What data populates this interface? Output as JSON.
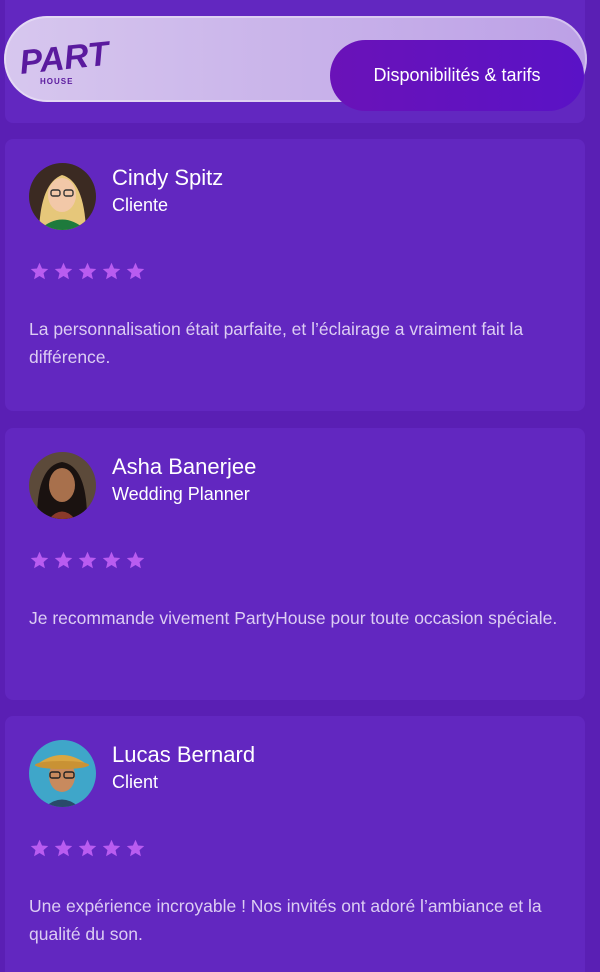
{
  "header": {
    "logo_text": "PARTY HOUSE",
    "cta_label": "Disponibilités & tarifs"
  },
  "colors": {
    "background": "#5a1fb4",
    "card": "#6227c0",
    "star": "#b95cf0",
    "cta": "#6a12b8"
  },
  "testimonials": [
    {
      "name": "Cindy Spitz",
      "role": "Cliente",
      "rating": 5,
      "text": "La personnalisation était parfaite, et l’éclairage a vraiment fait la différence."
    },
    {
      "name": "Asha Banerjee",
      "role": "Wedding Planner",
      "rating": 5,
      "text": "Je recommande vivement PartyHouse pour toute occasion spéciale."
    },
    {
      "name": "Lucas Bernard",
      "role": "Client",
      "rating": 5,
      "text": "Une expérience incroyable ! Nos invités ont adoré l’ambiance et la qualité du son."
    }
  ]
}
